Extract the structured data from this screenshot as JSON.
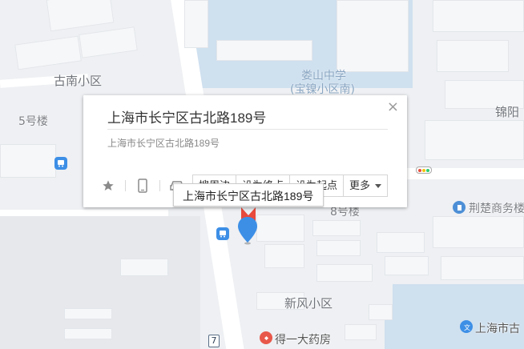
{
  "map": {
    "labels": {
      "gunan": "古南小区",
      "building5": "5号楼",
      "loushan1": "娄山中学",
      "loushan2": "(宝镍小区南)",
      "jinyang": "锦阳",
      "building8": "8号楼",
      "xinfeng": "新风小区",
      "jingchu": "荆楚商务楼",
      "deyida": "得一大药房",
      "shanghai_edge": "上海市古",
      "road_number": "7"
    },
    "colors": {
      "marker": "#3d8fe6",
      "red_marker": "#e84a3c",
      "water": "#cfe0ef"
    }
  },
  "popup": {
    "title": "上海市长宁区古北路189号",
    "address": "上海市长宁区古北路189号",
    "close_icon": "×",
    "actions": {
      "b1": "搜周边",
      "b2": "设为终点",
      "b3": "设为起点",
      "more": "更多"
    }
  },
  "tooltip": {
    "text": "上海市长宁区古北路189号"
  }
}
